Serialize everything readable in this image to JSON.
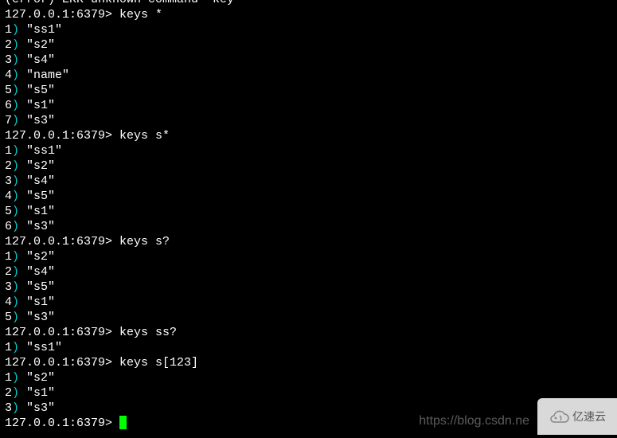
{
  "prompt_prefix": "127.0.0.1:6379> ",
  "top_line": "(error) ERR unknown command 'key'",
  "blocks": [
    {
      "cmd": "keys *",
      "rows": [
        "ss1",
        "s2",
        "s4",
        "name",
        "s5",
        "s1",
        "s3"
      ]
    },
    {
      "cmd": "keys s*",
      "rows": [
        "ss1",
        "s2",
        "s4",
        "s5",
        "s1",
        "s3"
      ]
    },
    {
      "cmd": "keys s?",
      "rows": [
        "s2",
        "s4",
        "s5",
        "s1",
        "s3"
      ]
    },
    {
      "cmd": "keys ss?",
      "rows": [
        "ss1"
      ]
    },
    {
      "cmd": "keys s[123]",
      "rows": [
        "s2",
        "s1",
        "s3"
      ]
    }
  ],
  "current_prompt": "127.0.0.1:6379> ",
  "watermark": "https://blog.csdn.ne",
  "badge_text": "亿速云"
}
